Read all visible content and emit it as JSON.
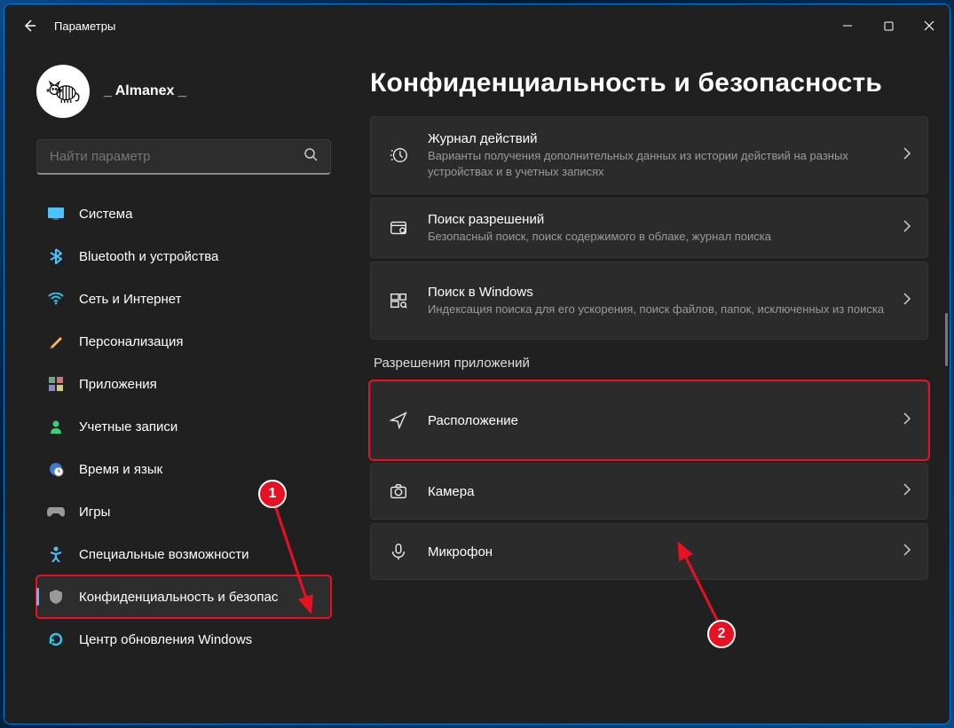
{
  "window": {
    "title": "Параметры"
  },
  "profile": {
    "username": "_ Almanex _"
  },
  "search": {
    "placeholder": "Найти параметр"
  },
  "nav": {
    "items": [
      {
        "label": "Система"
      },
      {
        "label": "Bluetooth и устройства"
      },
      {
        "label": "Сеть и Интернет"
      },
      {
        "label": "Персонализация"
      },
      {
        "label": "Приложения"
      },
      {
        "label": "Учетные записи"
      },
      {
        "label": "Время и язык"
      },
      {
        "label": "Игры"
      },
      {
        "label": "Специальные возможности"
      },
      {
        "label": "Конфиденциальность и безопас"
      },
      {
        "label": "Центр обновления Windows"
      }
    ]
  },
  "page": {
    "title": "Конфиденциальность и безопасность",
    "section_label": "Разрешения приложений",
    "items": [
      {
        "title": "Журнал действий",
        "sub": "Варианты получения дополнительных данных из истории действий на разных устройствах и в учетных записях"
      },
      {
        "title": "Поиск разрешений",
        "sub": "Безопасный поиск, поиск содержимого в облаке, журнал поиска"
      },
      {
        "title": "Поиск в Windows",
        "sub": "Индексация поиска для его ускорения, поиск файлов, папок, исключенных из поиска"
      }
    ],
    "perm_items": [
      {
        "title": "Расположение"
      },
      {
        "title": "Камера"
      },
      {
        "title": "Микрофон"
      }
    ]
  },
  "annotations": {
    "badge1": "1",
    "badge2": "2"
  }
}
